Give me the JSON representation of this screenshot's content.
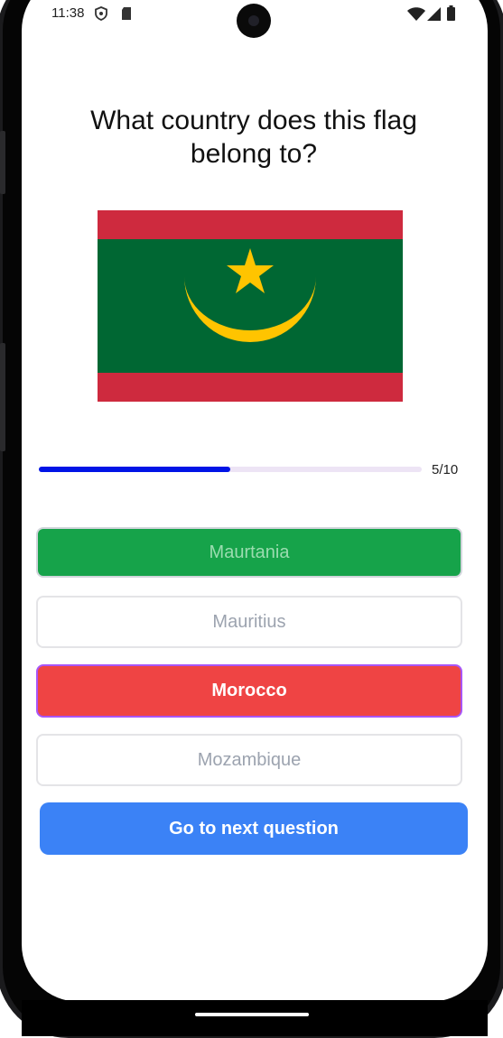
{
  "status_bar": {
    "time": "11:38",
    "left_icons": [
      "shield-icon",
      "sd-card-icon"
    ],
    "right_icons": [
      "wifi-icon",
      "signal-icon",
      "battery-icon"
    ]
  },
  "quiz": {
    "question": "What country does this flag belong to?",
    "flag": {
      "country_icon": "mauritania-flag",
      "colors": {
        "red": "#CE2A3E",
        "green": "#006733",
        "gold": "#FFC400"
      }
    },
    "progress": {
      "current": 5,
      "total": 10,
      "fraction": 0.5,
      "label": "5/10"
    },
    "options": [
      {
        "label": "Maurtania",
        "state": "correct"
      },
      {
        "label": "Mauritius",
        "state": "neutral"
      },
      {
        "label": "Morocco",
        "state": "selected-wrong"
      },
      {
        "label": "Mozambique",
        "state": "neutral"
      }
    ],
    "next_button_label": "Go to next question"
  },
  "colors": {
    "correct": "#16A34A",
    "wrong": "#EF4444",
    "selected_border": "#A855F7",
    "primary_button": "#3B82F6",
    "progress_fill": "#0014E6"
  }
}
